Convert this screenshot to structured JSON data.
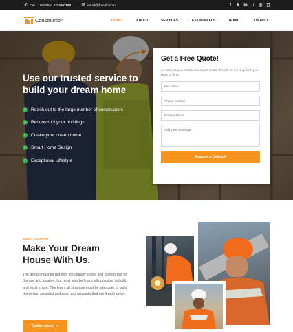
{
  "topbar": {
    "call_label": "CALL US NOW:",
    "phone": "1234567890",
    "email": "email@domain.com",
    "socials": [
      "facebook-icon",
      "twitter-icon",
      "linkedin-icon",
      "tiktok-icon",
      "whatsapp-icon",
      "instagram-icon"
    ]
  },
  "nav": {
    "logo_text": "Construction",
    "items": [
      {
        "label": "HOME",
        "active": true
      },
      {
        "label": "ABOUT",
        "active": false
      },
      {
        "label": "SERVICES",
        "active": false
      },
      {
        "label": "TESTIMONIALS",
        "active": false
      },
      {
        "label": "TEAM",
        "active": false
      },
      {
        "label": "CONTACT",
        "active": false
      }
    ]
  },
  "hero": {
    "title": "Use our trusted service to build your dream home",
    "bullets": [
      "Reach out to the large number of constructors",
      "Reconstruct your buildings",
      "Create your dream home",
      "Smart Home Design",
      "Exceptional Lifestyle"
    ]
  },
  "quote_form": {
    "title": "Get a Free Quote!",
    "description": "As soon as you contact our expert team, this will be the only form you have to fill in.",
    "full_name_placeholder": "Full name",
    "phone_placeholder": "Phone number",
    "email_placeholder": "Email address",
    "message_placeholder": "Add your message",
    "submit_label": "Request a Callback"
  },
  "about": {
    "kicker": "ABOUT COMPANY",
    "title": "Make Your Dream House With Us.",
    "text": "The design must be not only structurally sound and appropriate for the use and location, but must also be financially possible to build, and legal to use. The financial structure must be adequate to build the design provided and must pay amounts that are legally owed.",
    "button_label": "Explore more",
    "button_icon": "arrow-right-icon"
  },
  "colors": {
    "accent": "#f7941d",
    "check": "#38b24a",
    "topbar": "#1c1c1c"
  }
}
